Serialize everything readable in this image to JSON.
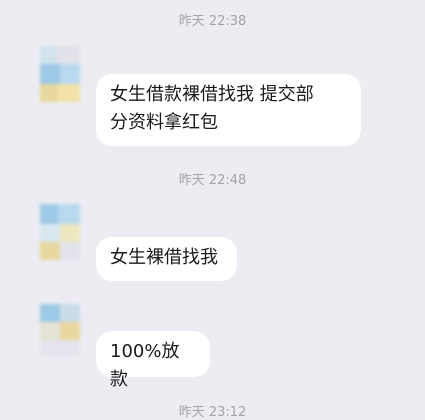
{
  "messages": [
    {
      "time": "昨天 22:38",
      "text_line1": "女生借款裸借找我  提交部",
      "text_line2": "分资料拿红包"
    },
    {
      "time": "昨天 22:48",
      "text": "女生裸借找我"
    },
    {
      "text": "100%放款"
    },
    {
      "time": "昨天 23:12"
    }
  ],
  "colors": {
    "background": "#ececf2",
    "bubble": "#ffffff",
    "timestamp": "#a3a3ab",
    "text": "#1a1a1a"
  },
  "icons": [
    "avatar-blurred"
  ]
}
